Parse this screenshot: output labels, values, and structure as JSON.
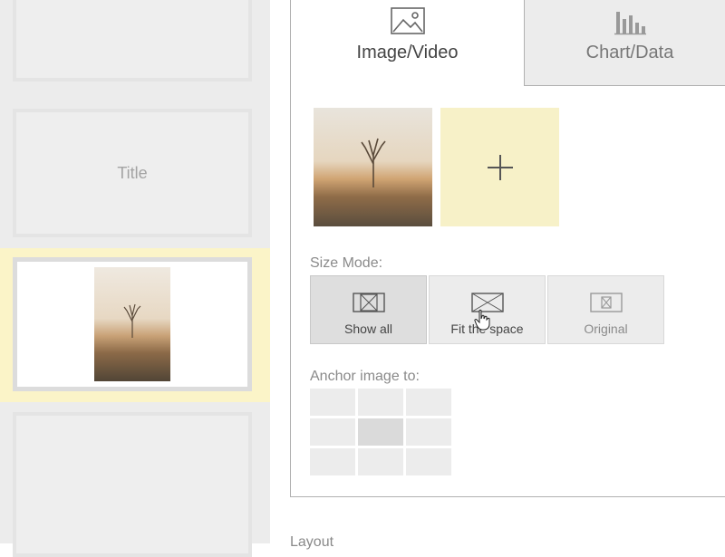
{
  "slides": [
    {
      "id": 1,
      "label": ""
    },
    {
      "id": 2,
      "label": "Title"
    },
    {
      "id": 3,
      "label": "",
      "selected": true
    },
    {
      "id": 4,
      "label": ""
    }
  ],
  "tabs": {
    "media": {
      "label": "Image/Video",
      "icon": "image-icon",
      "active": true
    },
    "chart": {
      "label": "Chart/Data",
      "icon": "bar-chart-icon",
      "active": false
    }
  },
  "add_media": {
    "icon": "plus-icon"
  },
  "size_mode": {
    "label": "Size Mode:",
    "options": [
      {
        "label": "Show all",
        "icon": "show-all-icon",
        "active": true
      },
      {
        "label": "Fit the space",
        "icon": "fit-space-icon",
        "active": false
      },
      {
        "label": "Original",
        "icon": "original-size-icon",
        "active": false
      }
    ]
  },
  "anchor": {
    "label": "Anchor image to:",
    "selected_cell": "middle-center"
  },
  "layout": {
    "label": "Layout"
  },
  "colors": {
    "selection_highlight": "#fbf4c8",
    "add_tile": "#f7f1c8",
    "panel_bg": "#ececec"
  }
}
